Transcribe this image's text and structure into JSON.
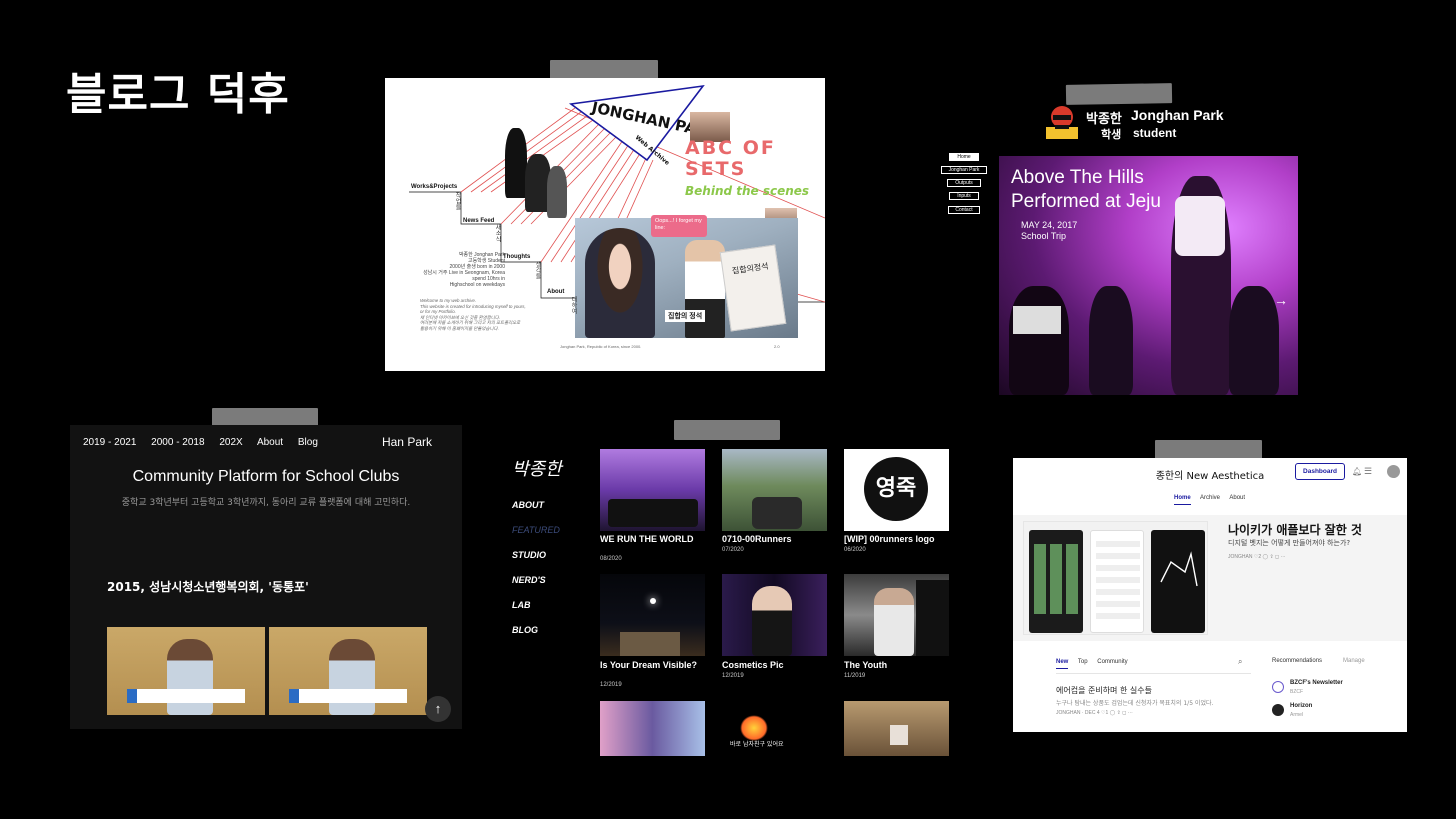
{
  "slide": {
    "title": "블로그 덕후"
  },
  "archive": {
    "logo_name": "JONGHAN PARK",
    "logo_sub": "Web Archive",
    "headline": "ABC OF SETS",
    "tagline": "Behind the scenes",
    "oops": "Oops...! I forget my line:",
    "book_title": "집합의정석",
    "caption": "집합의 정석",
    "nav": [
      {
        "label": "Works&Projects",
        "kr": "작업들"
      },
      {
        "label": "News Feed",
        "kr": "새소식"
      },
      {
        "label": "Thoughts",
        "kr": "생각들"
      },
      {
        "label": "About",
        "kr": "대하여"
      }
    ],
    "bio": [
      "박종한 Jonghan Park",
      "고등학생 Student",
      "2000년 출생 born in 2000",
      "성남시 거주 Live in Seongnam, Korea",
      "spend 10hrs in",
      "Highschool on weekdays"
    ],
    "welcome": [
      "Welcome to my web archive.",
      "This website is created for introducing myself to yours,",
      "or for my Portfolio.",
      "제 인터넷 아카이브에 오신 것을 환영합니다.",
      "여러분께 저를 소개하기 위해 그리고 저의 포트폴리오로",
      "활용하기 위해 이 홈페이지를 만들었습니다."
    ],
    "footer": "Jonghan Park, Republic of Korea, since 2000.",
    "version": "2.0"
  },
  "student": {
    "name_kr": "박종한",
    "name_en": "Jonghan Park",
    "role_kr": "학생",
    "role_en": "student",
    "nav": [
      "Home",
      "Jonghan Park",
      "Outputs",
      "Inputs",
      "Contact"
    ],
    "hero_title_1": "Above The Hills",
    "hero_title_2": "Performed at Jeju",
    "hero_date": "MAY 24, 2017",
    "hero_tag": "School Trip",
    "arrow": "→"
  },
  "hanpark": {
    "nav": [
      "2019 - 2021",
      "2000 - 2018",
      "202X",
      "About",
      "Blog"
    ],
    "brand": "Han Park",
    "title": "Community Platform for School Clubs",
    "subtitle": "중학교 3학년부터 고등학교 3학년까지, 동아리 교류 플랫폼에 대해 고민하다.",
    "section": "2015, 성남시청소년행복의회, '동통포'",
    "up_arrow": "↑"
  },
  "portfolio": {
    "signature": "박종한",
    "nav": [
      "ABOUT",
      "FEATURED",
      "STUDIO",
      "NERD'S",
      "LAB",
      "BLOG"
    ],
    "items": [
      {
        "title": "WE RUN THE WORLD",
        "date": "08/2020"
      },
      {
        "title": "0710-00Runners",
        "date": "07/2020"
      },
      {
        "title": "[WIP] 00runners logo",
        "date": "06/2020"
      },
      {
        "title": "Is Your Dream Visible?",
        "date": "12/2019"
      },
      {
        "title": "Cosmetics Pic",
        "date": "12/2019"
      },
      {
        "title": "The Youth",
        "date": "11/2019"
      }
    ],
    "logo_text": "영죽",
    "bottom_caption": "바로 남자친구 있어요"
  },
  "aesthetica": {
    "title": "종한의 New Aesthetica",
    "dashboard": "Dashboard",
    "tabs": [
      "Home",
      "Archive",
      "About"
    ],
    "post_title": "나이키가 애플보다 잘한 것",
    "post_sub": "디지털 벳지는 어떻게 만들어져야 하는가?",
    "post_meta": "JONGHAN   ♡2   ◯   ⇪   ◻   ···",
    "sub_tabs": [
      "New",
      "Top",
      "Community"
    ],
    "item_title": "에어컵을 준비하며 한 실수들",
    "item_sub": "누구나 탐내는 상품도 검엄는데 신청자가 목표치의 1/5 이었다.",
    "item_meta": "JONGHAN · DEC 4   ♡1   ◯   ⇪   ◻   ···",
    "rec_header": "Recommendations",
    "manage": "Manage",
    "recs": [
      {
        "name": "BZCF's Newsletter",
        "sub": "BZCF"
      },
      {
        "name": "Horizon",
        "sub": "Armel"
      }
    ]
  }
}
